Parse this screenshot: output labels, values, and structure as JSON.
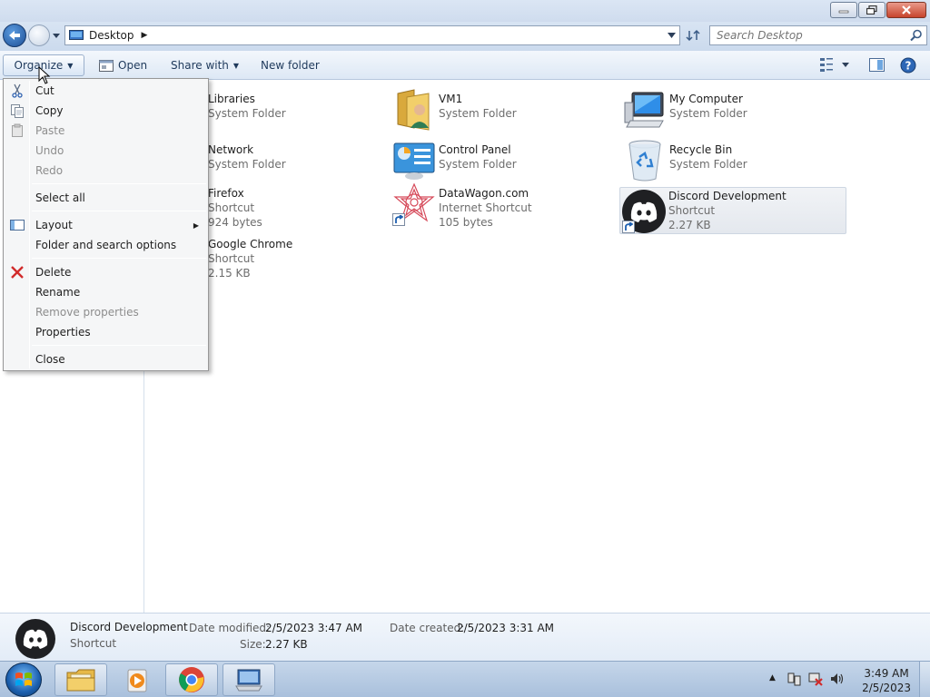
{
  "address": {
    "location": "Desktop"
  },
  "search": {
    "placeholder": "Search Desktop"
  },
  "toolbar": {
    "organize_label": "Organize",
    "open_label": "Open",
    "share_label": "Share with",
    "new_folder_label": "New folder"
  },
  "items": [
    {
      "name": "Libraries",
      "sub1": "System Folder",
      "sub2": "",
      "icon": "libraries-icon"
    },
    {
      "name": "VM1",
      "sub1": "System Folder",
      "sub2": "",
      "icon": "user-folder-icon"
    },
    {
      "name": "My Computer",
      "sub1": "System Folder",
      "sub2": "",
      "icon": "computer-icon"
    },
    {
      "name": "Network",
      "sub1": "System Folder",
      "sub2": "",
      "icon": "network-icon"
    },
    {
      "name": "Control Panel",
      "sub1": "System Folder",
      "sub2": "",
      "icon": "control-panel-icon"
    },
    {
      "name": "Recycle Bin",
      "sub1": "System Folder",
      "sub2": "",
      "icon": "recycle-bin-icon"
    },
    {
      "name": "Firefox",
      "sub1": "Shortcut",
      "sub2": "924 bytes",
      "icon": "firefox-icon"
    },
    {
      "name": "DataWagon.com",
      "sub1": "Internet Shortcut",
      "sub2": "105 bytes",
      "icon": "datawagon-icon"
    },
    {
      "name": "Discord Development",
      "sub1": "Shortcut",
      "sub2": "2.27 KB",
      "icon": "discord-icon"
    },
    {
      "name": "Google Chrome",
      "sub1": "Shortcut",
      "sub2": "2.15 KB",
      "icon": "chrome-icon"
    }
  ],
  "menu": {
    "cut": "Cut",
    "copy": "Copy",
    "paste": "Paste",
    "undo": "Undo",
    "redo": "Redo",
    "select_all": "Select all",
    "layout": "Layout",
    "folder_options": "Folder and search options",
    "delete": "Delete",
    "rename": "Rename",
    "remove_properties": "Remove properties",
    "properties": "Properties",
    "close": "Close"
  },
  "details": {
    "name": "Discord Development",
    "type": "Shortcut",
    "date_modified_label": "Date modified:",
    "date_modified": "2/5/2023 3:47 AM",
    "date_created_label": "Date created:",
    "date_created": "2/5/2023 3:31 AM",
    "size_label": "Size:",
    "size": "2.27 KB"
  },
  "taskbar": {
    "time": "3:49 AM",
    "date": "2/5/2023"
  },
  "colors": {
    "discord": "#1f2023",
    "delete_x": "#d12b2b",
    "close_button": "#c7442c"
  }
}
